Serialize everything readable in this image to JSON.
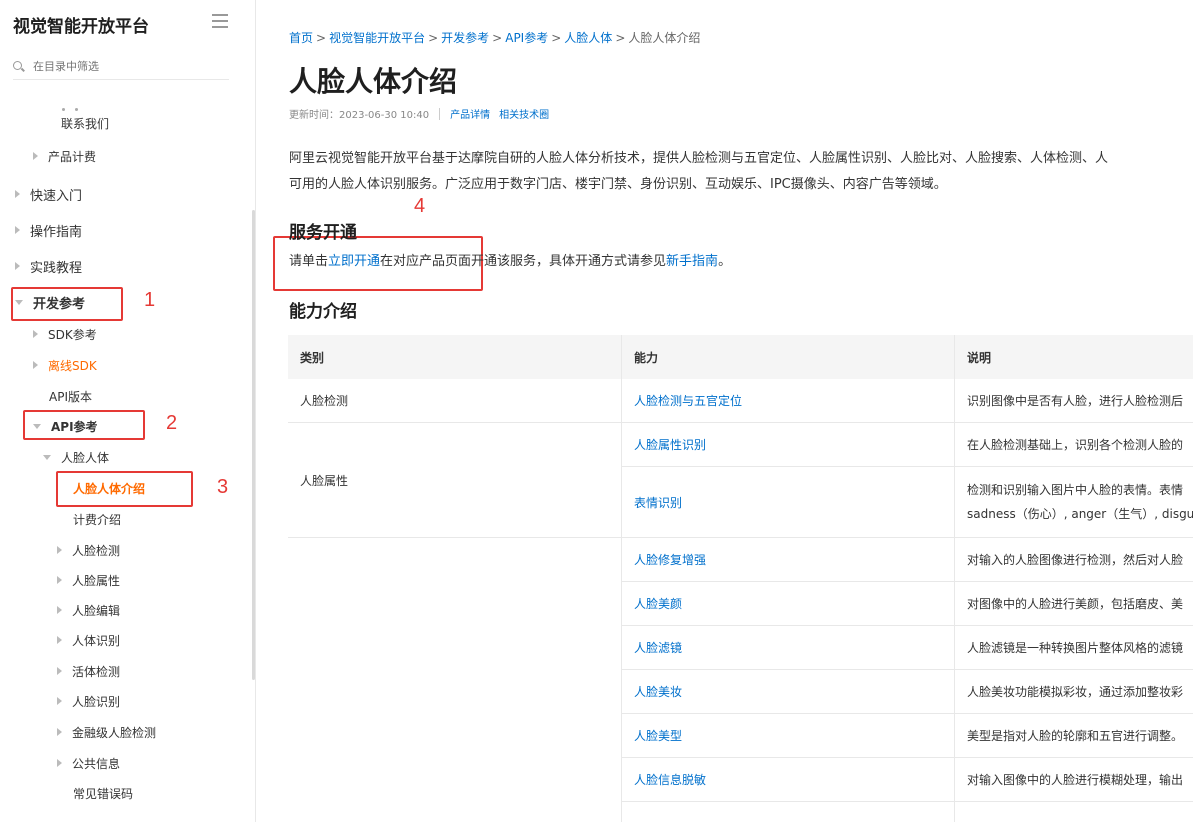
{
  "sidebar": {
    "title": "视觉智能开放平台",
    "search_placeholder": "在目录中筛选",
    "items": {
      "contact": "联系我们",
      "billing": "产品计费",
      "quickstart": "快速入门",
      "guide": "操作指南",
      "tutorial": "实践教程",
      "devref": "开发参考",
      "sdk": "SDK参考",
      "offline_sdk": "离线SDK",
      "api_version": "API版本",
      "api_ref": "API参考",
      "face_body": "人脸人体",
      "face_intro": "人脸人体介绍",
      "billing_intro": "计费介绍",
      "face_detect": "人脸检测",
      "face_attr": "人脸属性",
      "face_edit": "人脸编辑",
      "body_recog": "人体识别",
      "liveness": "活体检测",
      "face_recog": "人脸识别",
      "finance_face": "金融级人脸检测",
      "public_info": "公共信息",
      "error_codes": "常见错误码"
    }
  },
  "annotations": [
    "1",
    "2",
    "3",
    "4"
  ],
  "breadcrumb": {
    "home": "首页",
    "platform": "视觉智能开放平台",
    "devref": "开发参考",
    "api_ref": "API参考",
    "face_body": "人脸人体",
    "current": "人脸人体介绍",
    "sep": ">"
  },
  "page": {
    "title": "人脸人体介绍",
    "updated": "更新时间：2023-06-30 10:40",
    "link_product": "产品详情",
    "link_community": "相关技术圈",
    "intro_line1": "阿里云视觉智能开放平台基于达摩院自研的人脸人体分析技术，提供人脸检测与五官定位、人脸属性识别、人脸比对、人脸搜索、人体检测、人",
    "intro_line2": "可用的人脸人体识别服务。广泛应用于数字门店、楼宇门禁、身份识别、互动娱乐、IPC摄像头、内容广告等领域。",
    "service_heading": "服务开通",
    "service_prefix": "请单击",
    "service_link": "立即开通",
    "service_middle": "在对应产品页面开通该服务，具体开通方式请参见",
    "service_guide": "新手指南",
    "service_end": "。",
    "ability_heading": "能力介绍"
  },
  "table": {
    "headers": [
      "类别",
      "能力",
      "说明"
    ],
    "cat_detect": "人脸检测",
    "cat_attr": "人脸属性",
    "rows": [
      {
        "ability": "人脸检测与五官定位",
        "desc": "识别图像中是否有人脸，进行人脸检测后"
      },
      {
        "ability": "人脸属性识别",
        "desc": "在人脸检测基础上，识别各个检测人脸的"
      },
      {
        "ability": "表情识别",
        "desc": "检测和识别输入图片中人脸的表情。表情",
        "desc2": "sadness（伤心）, anger（生气）, disgu"
      },
      {
        "ability": "人脸修复增强",
        "desc": "对输入的人脸图像进行检测，然后对人脸"
      },
      {
        "ability": "人脸美颜",
        "desc": "对图像中的人脸进行美颜，包括磨皮、美"
      },
      {
        "ability": "人脸滤镜",
        "desc": "人脸滤镜是一种转换图片整体风格的滤镜"
      },
      {
        "ability": "人脸美妆",
        "desc": "人脸美妆功能模拟彩妆，通过添加整妆彩"
      },
      {
        "ability": "人脸美型",
        "desc": "美型是指对人脸的轮廓和五官进行调整。"
      },
      {
        "ability": "人脸信息脱敏",
        "desc": "对输入图像中的人脸进行模糊处理，输出"
      }
    ]
  }
}
